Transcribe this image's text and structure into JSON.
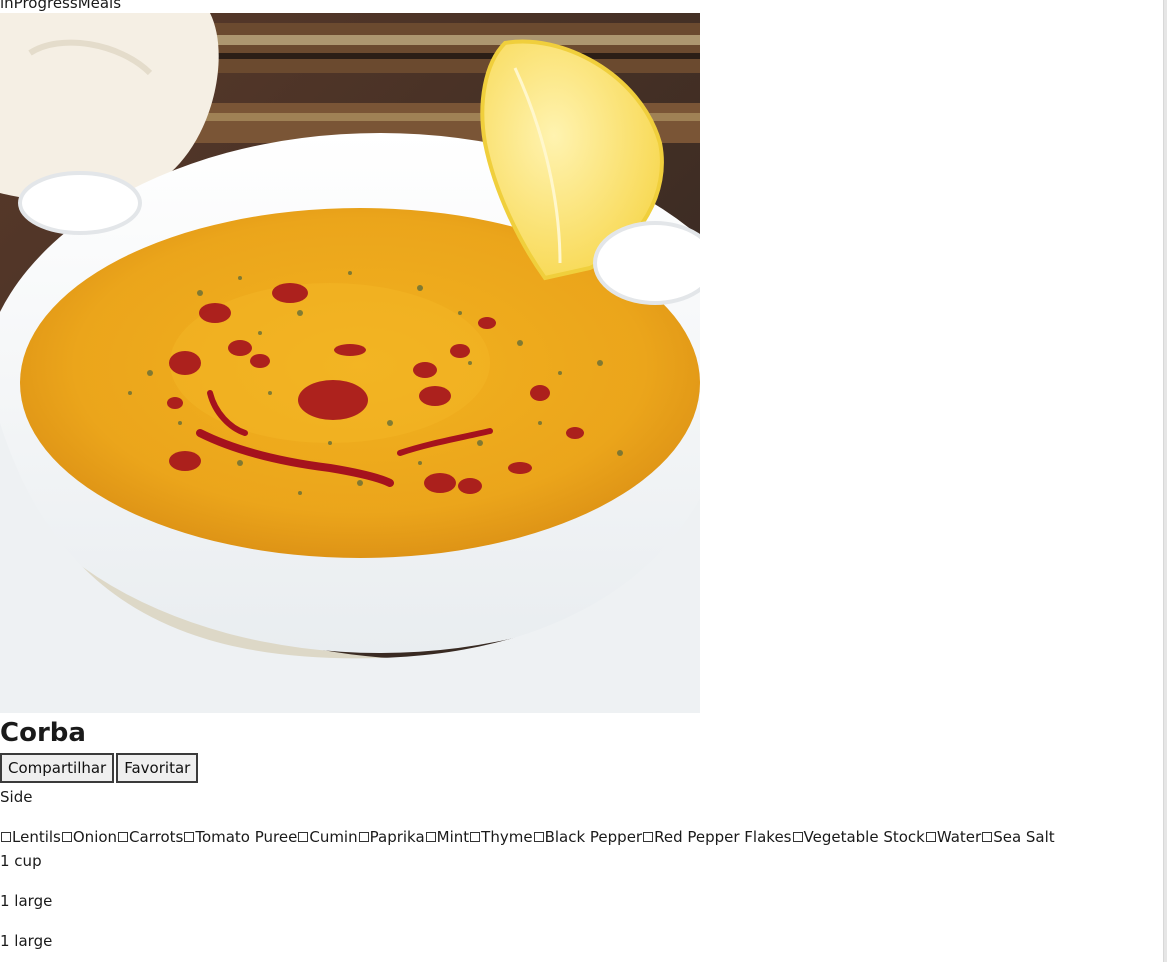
{
  "header": {
    "title": "inProgressMeals"
  },
  "recipe": {
    "photo_alt": "Corba",
    "title": "Corba",
    "category": "Side"
  },
  "actions": {
    "share_label": "Compartilhar",
    "favorite_label": "Favoritar"
  },
  "ingredients": [
    {
      "name": "Lentils",
      "checked": false
    },
    {
      "name": "Onion",
      "checked": false
    },
    {
      "name": "Carrots",
      "checked": false
    },
    {
      "name": "Tomato Puree",
      "checked": false
    },
    {
      "name": "Cumin",
      "checked": false
    },
    {
      "name": "Paprika",
      "checked": false
    },
    {
      "name": "Mint",
      "checked": false
    },
    {
      "name": "Thyme",
      "checked": false
    },
    {
      "name": "Black Pepper",
      "checked": false
    },
    {
      "name": "Red Pepper Flakes",
      "checked": false
    },
    {
      "name": "Vegetable Stock",
      "checked": false
    },
    {
      "name": "Water",
      "checked": false
    },
    {
      "name": "Sea Salt",
      "checked": false
    }
  ],
  "measures": [
    "1 cup",
    "1 large",
    "1 large"
  ]
}
